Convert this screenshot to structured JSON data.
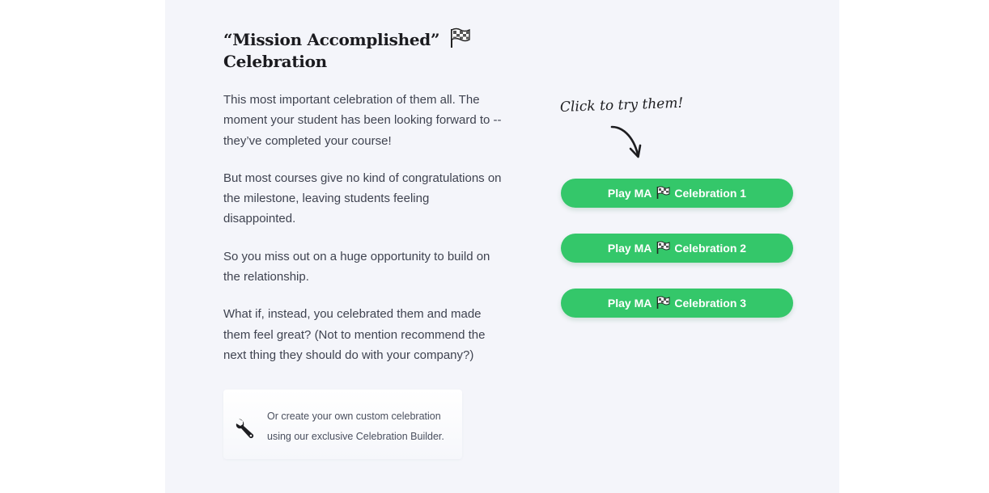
{
  "section": {
    "title_line1": "“Mission Accomplished”",
    "title_line2": "Celebration",
    "title_icon": "checkered-flag-icon",
    "paragraphs": [
      "This most important celebration of them all. The moment your student has been looking forward to -- they’ve completed your course!",
      "But most courses give no kind of congratulations on the milestone, leaving students feeling disappointed.",
      "So you miss out on a huge opportunity to build on the relationship.",
      "What if, instead, you celebrated them and made them feel great? (Not to mention recommend the next thing they should do with your company?)"
    ],
    "callout": {
      "icon": "wrench-icon",
      "text": "Or create your own custom celebration using our exclusive Celebration Builder."
    }
  },
  "demo": {
    "hint": "Click to try them!",
    "buttons": [
      {
        "prefix": "Play MA",
        "suffix": "Celebration 1",
        "icon": "checkered-flag-icon"
      },
      {
        "prefix": "Play MA",
        "suffix": "Celebration 2",
        "icon": "checkered-flag-icon"
      },
      {
        "prefix": "Play MA",
        "suffix": "Celebration 3",
        "icon": "checkered-flag-icon"
      }
    ],
    "button_color": "#34c76a"
  },
  "colors": {
    "panel_background": "#f4f5fa",
    "heading": "#1b1b1f",
    "body_text": "#3f4350"
  }
}
